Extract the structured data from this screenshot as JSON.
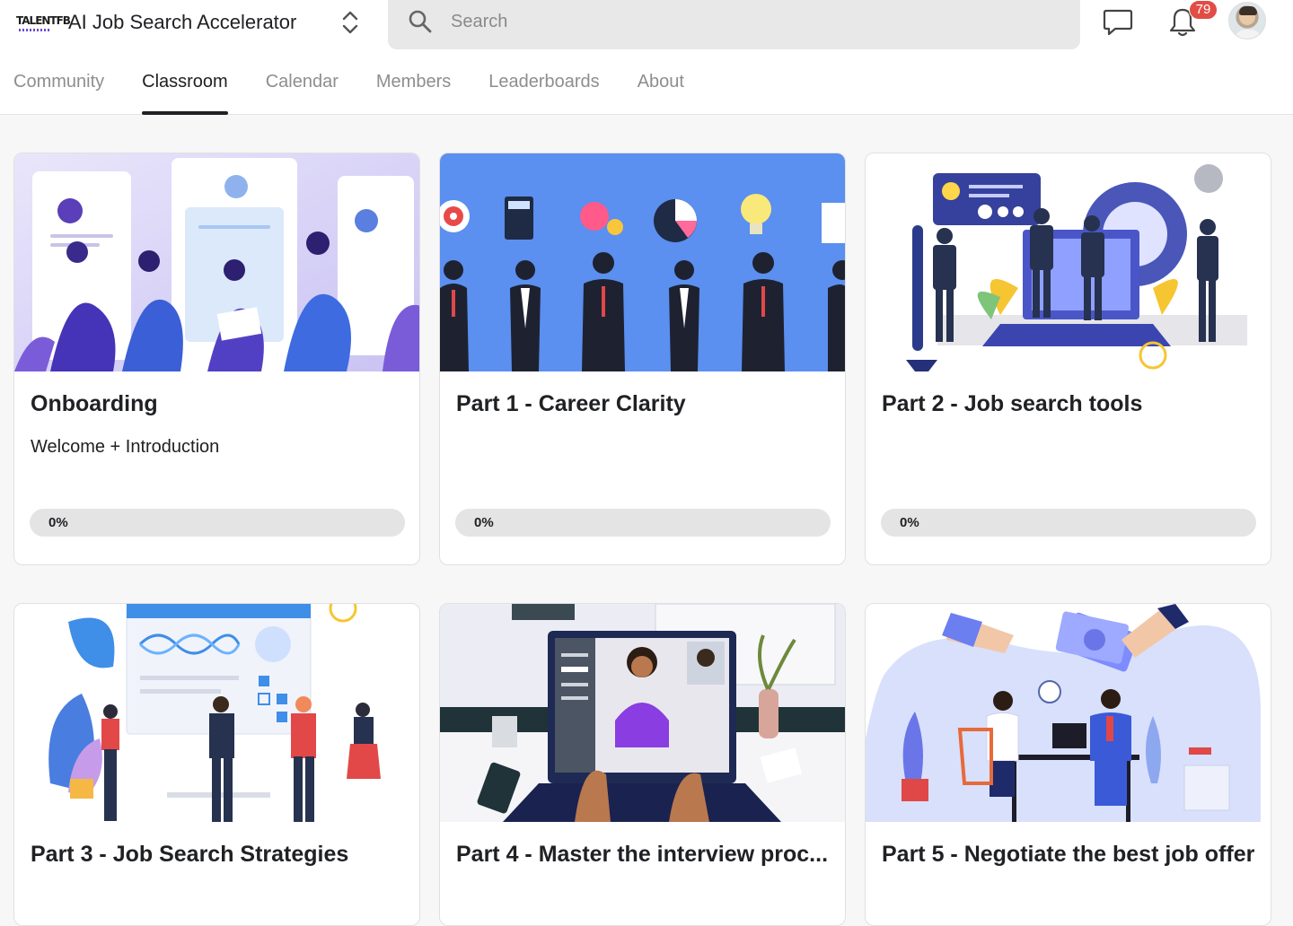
{
  "header": {
    "logo_text": "TALENTFB",
    "group_name": "AI Job Search Accelerator",
    "search_placeholder": "Search",
    "notification_count": "79"
  },
  "tabs": [
    {
      "label": "Community",
      "active": false
    },
    {
      "label": "Classroom",
      "active": true
    },
    {
      "label": "Calendar",
      "active": false
    },
    {
      "label": "Members",
      "active": false
    },
    {
      "label": "Leaderboards",
      "active": false
    },
    {
      "label": "About",
      "active": false
    }
  ],
  "courses": [
    {
      "title": "Onboarding",
      "description": "Welcome + Introduction",
      "progress_label": "0%",
      "progress": 0
    },
    {
      "title": "Part 1 - Career Clarity",
      "description": "",
      "progress_label": "0%",
      "progress": 0
    },
    {
      "title": "Part 2 - Job search tools",
      "description": "",
      "progress_label": "0%",
      "progress": 0
    },
    {
      "title": "Part 3 - Job Search Strategies",
      "description": ""
    },
    {
      "title": "Part 4 - Master the interview proc...",
      "description": ""
    },
    {
      "title": "Part 5 - Negotiate the best job offer",
      "description": ""
    }
  ],
  "colors": {
    "accent": "#202124",
    "badge": "#e14d45",
    "progress_track": "#e4e4e4",
    "career_clarity_bg": "#5b8ff0"
  }
}
